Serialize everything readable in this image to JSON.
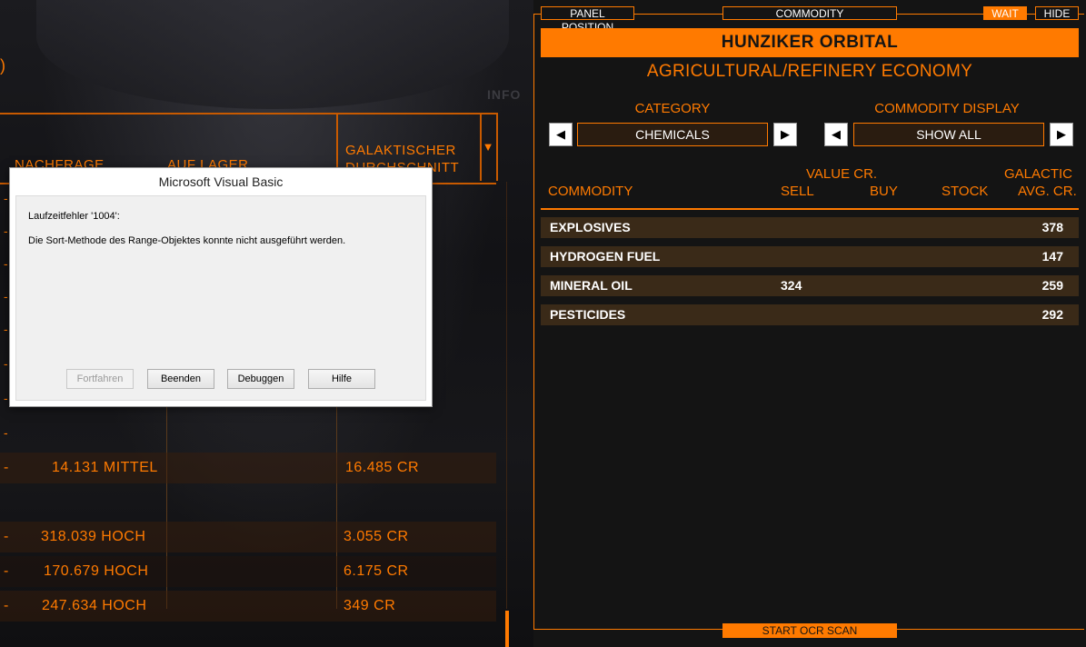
{
  "background_game": {
    "paren": ")",
    "info_text": "INFO",
    "columns": {
      "demand": "NACHFRAGE",
      "stock": "AUF LAGER",
      "galactic_line1": "GALAKTISCHER",
      "galactic_line2": "DURCHSCHNITT"
    },
    "dropdown_glyph": "▼",
    "rows": [
      {
        "demand": "14.131 MITTEL",
        "galactic": "16.485 CR"
      },
      {
        "demand": "318.039 HOCH",
        "galactic": "3.055 CR"
      },
      {
        "demand": "170.679 HOCH",
        "galactic": "6.175 CR"
      },
      {
        "demand": "247.634 HOCH",
        "galactic": "349 CR"
      }
    ]
  },
  "dialog": {
    "title": "Microsoft Visual Basic",
    "error_line": "Laufzeitfehler '1004':",
    "message": "Die Sort-Methode des Range-Objektes konnte nicht ausgeführt werden.",
    "buttons": {
      "continue": "Fortfahren",
      "end": "Beenden",
      "debug": "Debuggen",
      "help": "Hilfe"
    }
  },
  "overlay": {
    "panel_position": "PANEL POSITION",
    "commodity_tab": "COMMODITY",
    "wait": "WAIT",
    "hide": "HIDE",
    "station": "HUNZIKER ORBITAL",
    "economy": "AGRICULTURAL/REFINERY ECONOMY",
    "category_label": "CATEGORY",
    "category_value": "CHEMICALS",
    "display_label": "COMMODITY DISPLAY",
    "display_value": "SHOW ALL",
    "headers": {
      "value_cr": "VALUE CR.",
      "galactic": "GALACTIC",
      "commodity": "COMMODITY",
      "sell": "SELL",
      "buy": "BUY",
      "stock": "STOCK",
      "avg_cr": "AVG. CR."
    },
    "commodities": [
      {
        "name": "EXPLOSIVES",
        "sell": "",
        "avg": "378"
      },
      {
        "name": "HYDROGEN FUEL",
        "sell": "",
        "avg": "147"
      },
      {
        "name": "MINERAL OIL",
        "sell": "324",
        "avg": "259"
      },
      {
        "name": "PESTICIDES",
        "sell": "",
        "avg": "292"
      }
    ],
    "ocr_button": "START OCR SCAN"
  },
  "colors": {
    "accent": "#ff7a00",
    "panel_bg": "#141414",
    "row_bg": "#3a2a18"
  }
}
